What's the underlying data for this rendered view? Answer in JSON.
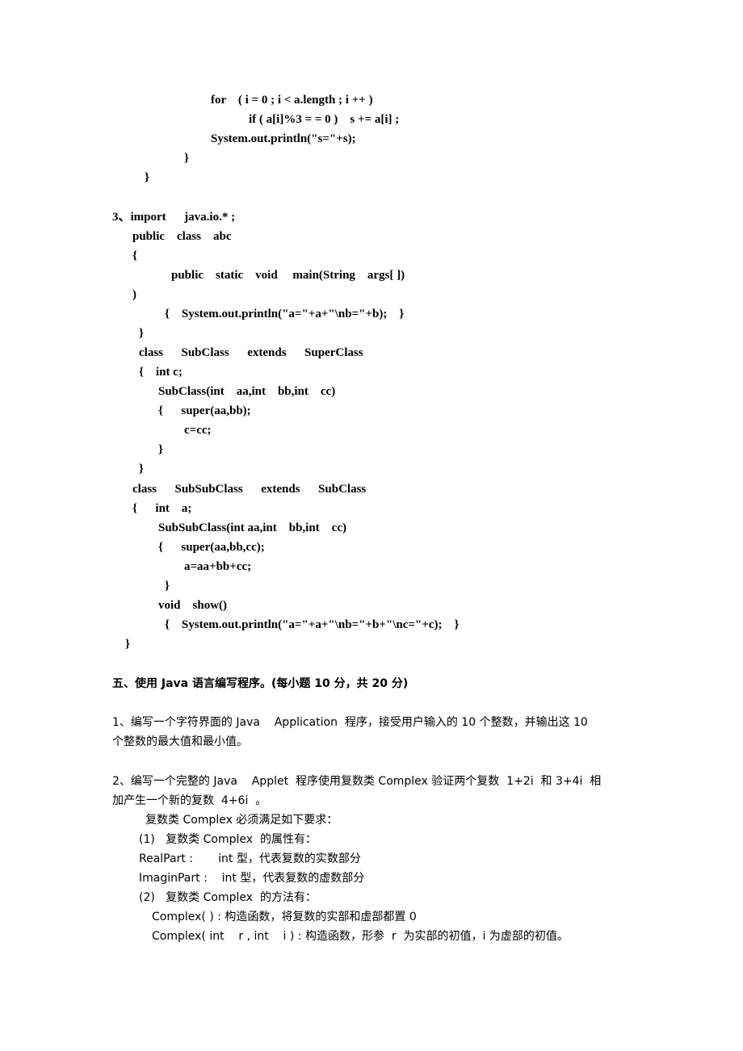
{
  "code_fragment_2": [
    "for    ( i = 0 ; i < a.length ; i ++ )",
    "if ( a[i]%3 = = 0 )    s += a[i] ;",
    "System.out.println(\"s=\"+s);",
    "}",
    "}"
  ],
  "question_3": {
    "label": "3、import      java.io.* ;",
    "lines": [
      "public    class    abc",
      "{",
      "public    static    void     main(String    args[ ])",
      ")",
      "{    System.out.println(\"a=\"+a+\"\\nb=\"+b);    }",
      "}",
      "class      SubClass      extends      SuperClass",
      "{    int c;",
      "SubClass(int    aa,int    bb,int    cc)",
      "{      super(aa,bb);",
      "c=cc;",
      "}",
      "}",
      "class      SubSubClass      extends      SubClass",
      "{      int    a;",
      "SubSubClass(int aa,int    bb,int    cc)",
      "{      super(aa,bb,cc);",
      "a=aa+bb+cc;",
      "}",
      "void    show()",
      "{    System.out.println(\"a=\"+a+\"\\nb=\"+b+\"\\nc=\"+c);    }",
      "}"
    ]
  },
  "section_5": {
    "heading": "五、使用 Java 语言编写程序。(每小题 10 分，共 20 分)",
    "q1": {
      "line1": "1、编写一个字符界面的 Java    Application  程序，接受用户输入的 10 个整数，并输出这 10",
      "line2": "个整数的最大值和最小值。"
    },
    "q2": {
      "line1": "2、编写一个完整的 Java    Applet  程序使用复数类 Complex 验证两个复数  1+2i  和 3+4i  相",
      "line2": "加产生一个新的复数  4+6i  。",
      "requirement": "复数类 Complex 必须满足如下要求：",
      "attr_heading": "(1)   复数类 Complex  的属性有：",
      "attrs": [
        "RealPart :       int 型，代表复数的实数部分",
        "ImaginPart :    int 型，代表复数的虚数部分"
      ],
      "method_heading": "(2)   复数类 Complex  的方法有：",
      "methods": [
        "Complex( ) : 构造函数，将复数的实部和虚部都置 0",
        "Complex( int    r , int    i ) : 构造函数，形参  r  为实部的初值，i 为虚部的初值。"
      ]
    }
  }
}
